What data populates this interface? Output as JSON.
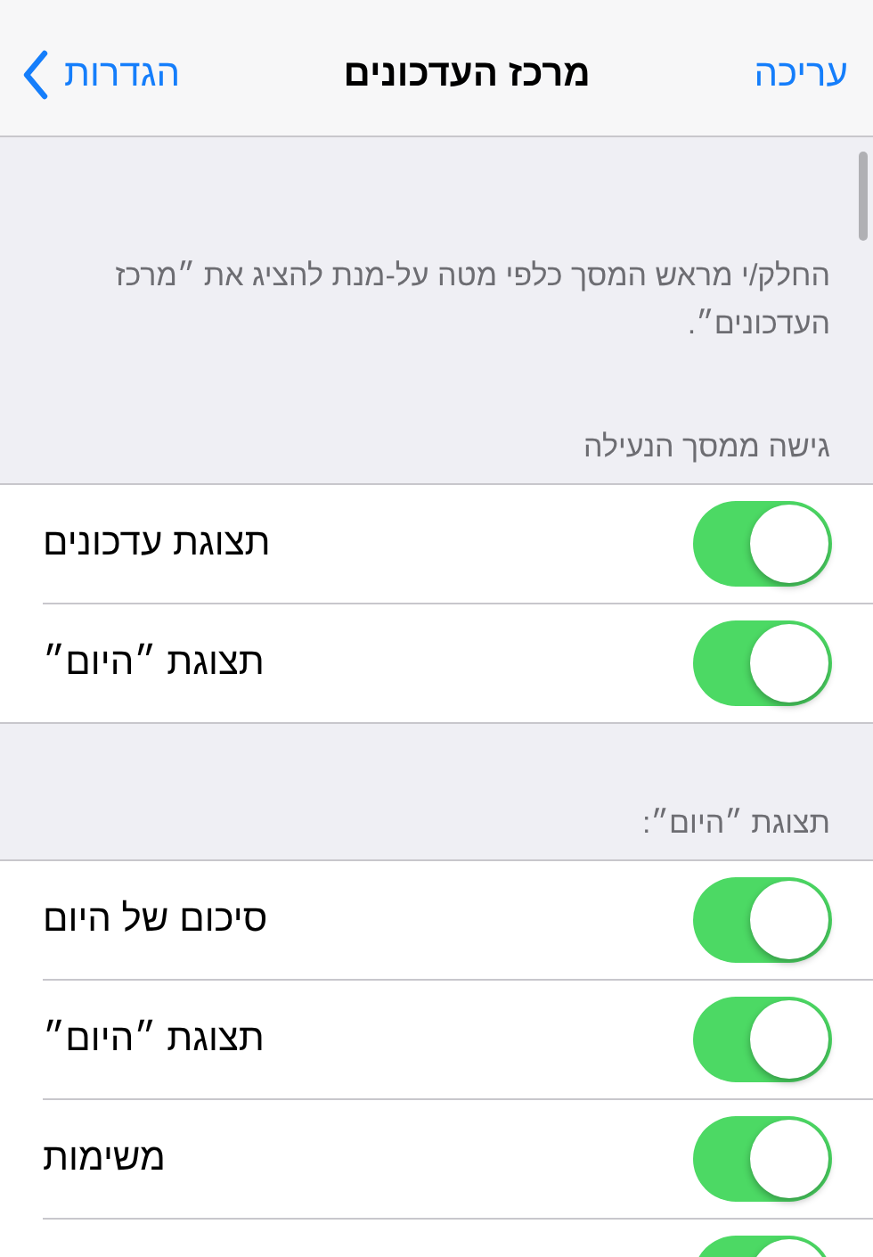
{
  "nav_bar": {
    "back_label": "הגדרות",
    "title": "מרכז העדכונים",
    "action": "עריכה"
  },
  "intro": {
    "text": "החלק/י מראש המסך כלפי מטה על-מנת להציג את ״מרכז העדכונים״."
  },
  "sections": [
    {
      "header": "גישה ממסך הנעילה",
      "rows": [
        {
          "label": "תצוגת עדכונים",
          "on": true
        },
        {
          "label": "תצוגת ״היום״",
          "on": true
        }
      ]
    },
    {
      "header": "תצוגת ״היום״:",
      "rows": [
        {
          "label": "סיכום של היום",
          "on": true
        },
        {
          "label": "תצוגת ״היום״",
          "on": true
        },
        {
          "label": "משימות",
          "on": true
        },
        {
          "on": true
        }
      ]
    }
  ]
}
